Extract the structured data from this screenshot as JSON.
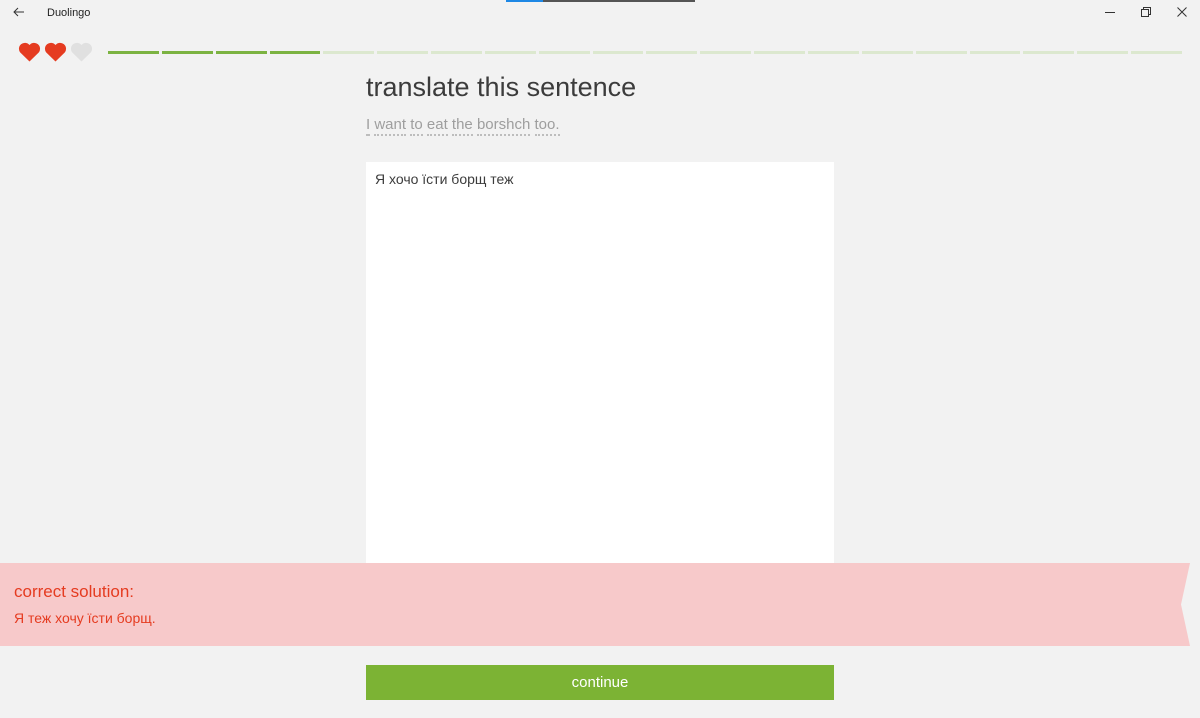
{
  "window": {
    "title": "Duolingo",
    "controls": [
      "back-icon",
      "minimize-icon",
      "restore-icon",
      "close-icon"
    ]
  },
  "lesson": {
    "hearts": [
      {
        "state": "full",
        "icon": "heart-icon",
        "color": "#e53b20"
      },
      {
        "state": "full",
        "icon": "heart-icon",
        "color": "#e53b20"
      },
      {
        "state": "empty",
        "icon": "heart-icon",
        "color": "#e0e0e0"
      }
    ],
    "progress": {
      "completed": 4,
      "total": 20,
      "color_done": "#7cb342",
      "color_todo": "#dce8cf"
    }
  },
  "prompt": {
    "title": "translate this sentence",
    "sentence_words": [
      "I",
      "want",
      "to",
      "eat",
      "the",
      "borshch",
      "too."
    ]
  },
  "answer": {
    "value": "Я хочо їсти борщ теж"
  },
  "feedback": {
    "heading": "correct solution:",
    "solution": "Я теж хочу їсти борщ.",
    "color": "#e53b20",
    "background": "#f7c9ca"
  },
  "footer": {
    "continue_label": "continue",
    "color": "#7cb334"
  }
}
